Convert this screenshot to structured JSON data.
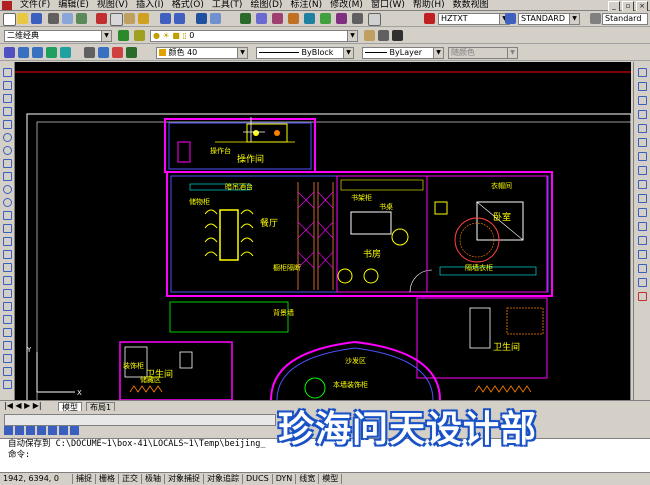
{
  "menu": {
    "items": [
      "文件(F)",
      "编辑(E)",
      "视图(V)",
      "插入(I)",
      "格式(O)",
      "工具(T)",
      "绘图(D)",
      "标注(N)",
      "修改(M)",
      "窗口(W)",
      "帮助(H)",
      "数数视图"
    ]
  },
  "toolbar1": {
    "text_style": "HZTXT",
    "dim_style": "STANDARD",
    "table_style": "Standard"
  },
  "toolbar2": {
    "workspace": "二维经典",
    "layer": "0",
    "color": "颜色 40",
    "linetype": "ByBlock",
    "lineweight": "ByLayer",
    "plotstyle": "随颜色"
  },
  "drawing": {
    "labels": [
      {
        "text": "操作台"
      },
      {
        "text": "操作间"
      },
      {
        "text": "暗吊酒台"
      },
      {
        "text": "餐厅"
      },
      {
        "text": "储物柜"
      },
      {
        "text": "橱柜隔断"
      },
      {
        "text": "书房"
      },
      {
        "text": "衣帽间"
      },
      {
        "text": "卧室"
      },
      {
        "text": "隔墙衣柜"
      },
      {
        "text": "卫生间"
      },
      {
        "text": "卫生间"
      },
      {
        "text": "装饰柜"
      },
      {
        "text": "储藏区"
      },
      {
        "text": "本墙装饰柜"
      },
      {
        "text": "背景墙"
      },
      {
        "text": "书架柜"
      },
      {
        "text": "书桌"
      },
      {
        "text": "沙发区"
      }
    ]
  },
  "tabs": {
    "items": [
      "模型",
      "布局1"
    ]
  },
  "command": {
    "line1": "自动保存到 C:\\DOCUME~1\\box-41\\LOCALS~1\\Temp\\beijing_",
    "line2": "命令:"
  },
  "status": {
    "coords": "1942, 6394, 0",
    "toggles": [
      "捕捉",
      "栅格",
      "正交",
      "极轴",
      "对象捕捉",
      "对象追踪",
      "DUCS",
      "DYN",
      "线宽",
      "模型"
    ]
  },
  "watermark": {
    "text": "珍海问天设计部"
  },
  "colors": {
    "canvas": "#000000",
    "wall": "#ff00ff",
    "frame": "#ffffff",
    "furniture": "#ffff00",
    "hatch": "#00ffff"
  }
}
